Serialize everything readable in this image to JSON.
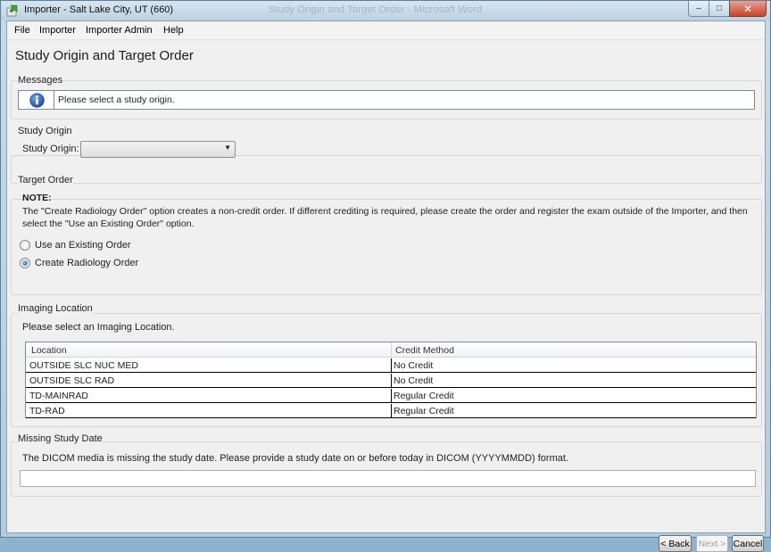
{
  "window": {
    "title": "Importer - Salt Lake City, UT (660)",
    "title_faded": "Study Origin and Target Order - Microsoft Word",
    "minimize_glyph": "‒",
    "maximize_glyph": "□",
    "close_glyph": "✕"
  },
  "menu": {
    "file": "File",
    "importer": "Importer",
    "importer_admin": "Importer Admin",
    "help": "Help"
  },
  "page": {
    "title": "Study Origin and Target Order"
  },
  "messages": {
    "label": "Messages",
    "text": "Please select a study origin.",
    "icon": "info-icon"
  },
  "study_origin": {
    "group_label": "Study Origin",
    "field_label": "Study Origin:",
    "selected_value": "",
    "arrow": "▼"
  },
  "target_order": {
    "group_label": "Target Order",
    "note_title": "NOTE:",
    "note_text": "The \"Create Radiology Order\" option creates a non-credit order. If different crediting is required, please create the order and register the exam outside of the Importer, and then select the \"Use an Existing Order\" option.",
    "options": [
      {
        "label": "Use an Existing Order",
        "checked": false
      },
      {
        "label": "Create Radiology Order",
        "checked": true
      }
    ]
  },
  "imaging_location": {
    "group_label": "Imaging Location",
    "prompt": "Please select an Imaging Location.",
    "columns": [
      "Location",
      "Credit Method"
    ],
    "rows": [
      [
        "OUTSIDE SLC NUC MED",
        "No Credit"
      ],
      [
        "OUTSIDE SLC RAD",
        "No Credit"
      ],
      [
        "TD-MAINRAD",
        "Regular Credit"
      ],
      [
        "TD-RAD",
        "Regular Credit"
      ]
    ]
  },
  "missing_study_date": {
    "group_label": "Missing Study Date",
    "text": "The DICOM media is missing the study date. Please provide a study date on or before today in DICOM (YYYYMMDD) format.",
    "value": ""
  },
  "buttons": {
    "back": "< Back",
    "next": "Next >",
    "cancel": "Cancel"
  },
  "colors": {
    "window_frame": "#b4cbdc",
    "content_bg": "#f0f0f0",
    "radio_selected": "#1f5e99",
    "info_blue": "#1e4f9c"
  }
}
